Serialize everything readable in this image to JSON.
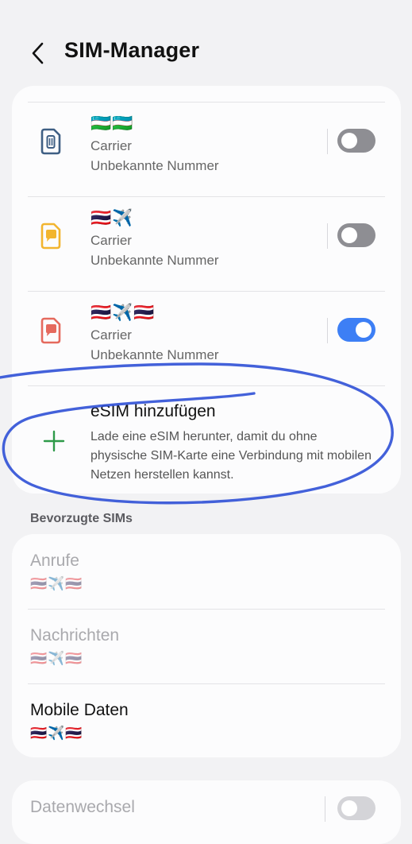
{
  "header": {
    "title": "SIM-Manager"
  },
  "sims": [
    {
      "flags": "🇺🇿🇺🇿",
      "carrier": "Carrier",
      "number": "Unbekannte Nummer",
      "icon": "sim-card-icon",
      "icon_color": "#3f5f84",
      "enabled": false
    },
    {
      "flags": "🇹🇭✈️",
      "carrier": "Carrier",
      "number": "Unbekannte Nummer",
      "icon": "sim-chat-icon",
      "icon_color": "#f2b52f",
      "enabled": false
    },
    {
      "flags": "🇹🇭✈️🇹🇭",
      "carrier": "Carrier",
      "number": "Unbekannte Nummer",
      "icon": "sim-chat-icon",
      "icon_color": "#e56a5e",
      "enabled": true
    }
  ],
  "add_esim": {
    "title": "eSIM hinzufügen",
    "description": "Lade eine eSIM herunter, damit du ohne physische SIM-Karte eine Verbindung mit mobilen Netzen herstellen kannst.",
    "icon": "plus-icon",
    "icon_color": "#2e9a49"
  },
  "preferred": {
    "section_label": "Bevorzugte SIMs",
    "items": [
      {
        "label": "Anrufe",
        "flags": "🇹🇭✈️🇹🇭",
        "active": false
      },
      {
        "label": "Nachrichten",
        "flags": "🇹🇭✈️🇹🇭",
        "active": false
      },
      {
        "label": "Mobile Daten",
        "flags": "🇹🇭✈️🇹🇭",
        "active": true
      }
    ]
  },
  "data_switch": {
    "label": "Datenwechsel",
    "enabled": false
  },
  "colors": {
    "toggle_on": "#3d7ff5",
    "toggle_off": "#8e8e93",
    "annotation": "#2f50d6"
  }
}
